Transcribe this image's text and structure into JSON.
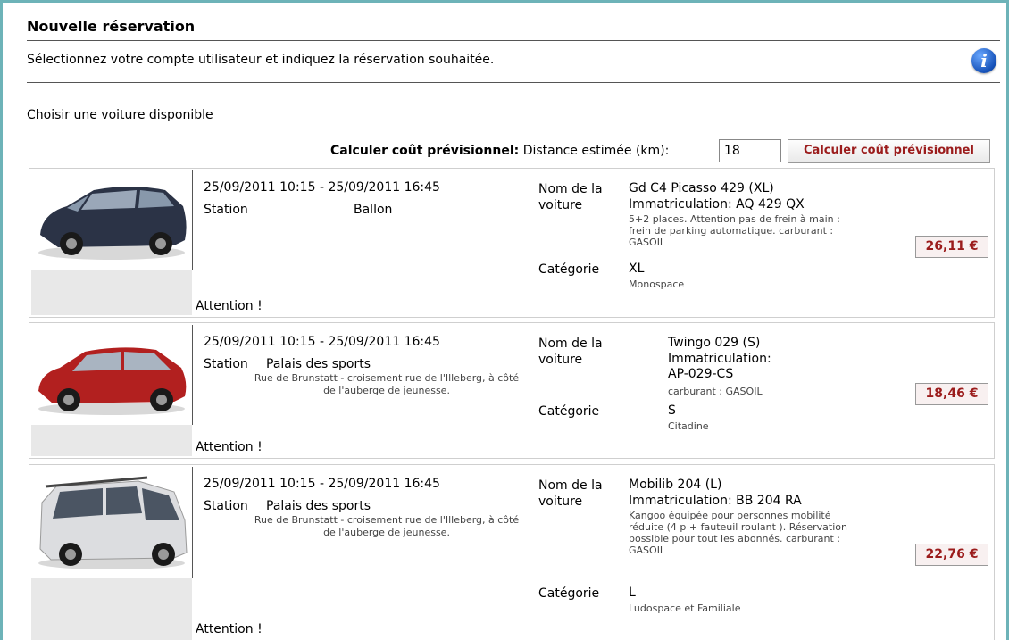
{
  "page": {
    "title": "Nouvelle réservation",
    "subtitle": "Sélectionnez votre compte utilisateur et indiquez la réservation souhaitée.",
    "info_icon": "info-icon",
    "choose_label": "Choisir une voiture disponible"
  },
  "estimate": {
    "label_bold": "Calculer coût prévisionnel:",
    "label_rest": "Distance estimée (km):",
    "distance": "18",
    "button": "Calculer coût prévisionnel"
  },
  "labels": {
    "station": "Station",
    "car_name": "Nom de la voiture",
    "category": "Catégorie",
    "attention": "Attention !"
  },
  "cars": [
    {
      "dates": "25/09/2011 10:15 - 25/09/2011 16:45",
      "station": "Ballon",
      "address": "",
      "name": "Gd C4 Picasso 429 (XL)",
      "plate": "Immatriculation: AQ 429 QX",
      "desc": "5+2 places. Attention pas de frein à main : frein de parking automatique. carburant : GASOIL",
      "category": "XL",
      "category_sub": "Monospace",
      "price": "26,11 €",
      "color": "#2b3346"
    },
    {
      "dates": "25/09/2011 10:15 - 25/09/2011 16:45",
      "station": "Palais des sports",
      "address": "Rue de Brunstatt - croisement rue de l'Illeberg, à côté de l'auberge de jeunesse.",
      "name": "Twingo 029 (S)",
      "plate": "Immatriculation: AP-029-CS",
      "desc": "carburant : GASOIL",
      "category": "S",
      "category_sub": "Citadine",
      "price": "18,46 €",
      "color": "#b2201f"
    },
    {
      "dates": "25/09/2011 10:15 - 25/09/2011 16:45",
      "station": "Palais des sports",
      "address": "Rue de Brunstatt - croisement rue de l'Illeberg, à côté de l'auberge de jeunesse.",
      "name": "Mobilib 204 (L)",
      "plate": "Immatriculation: BB 204 RA",
      "desc": "Kangoo équipée pour personnes mobilité réduite (4 p + fauteuil roulant ). Réservation possible pour tout les abonnés. carburant : GASOIL",
      "category": "L",
      "category_sub": "Ludospace et Familiale",
      "price": "22,76 €",
      "color": "#dcdde0"
    }
  ]
}
